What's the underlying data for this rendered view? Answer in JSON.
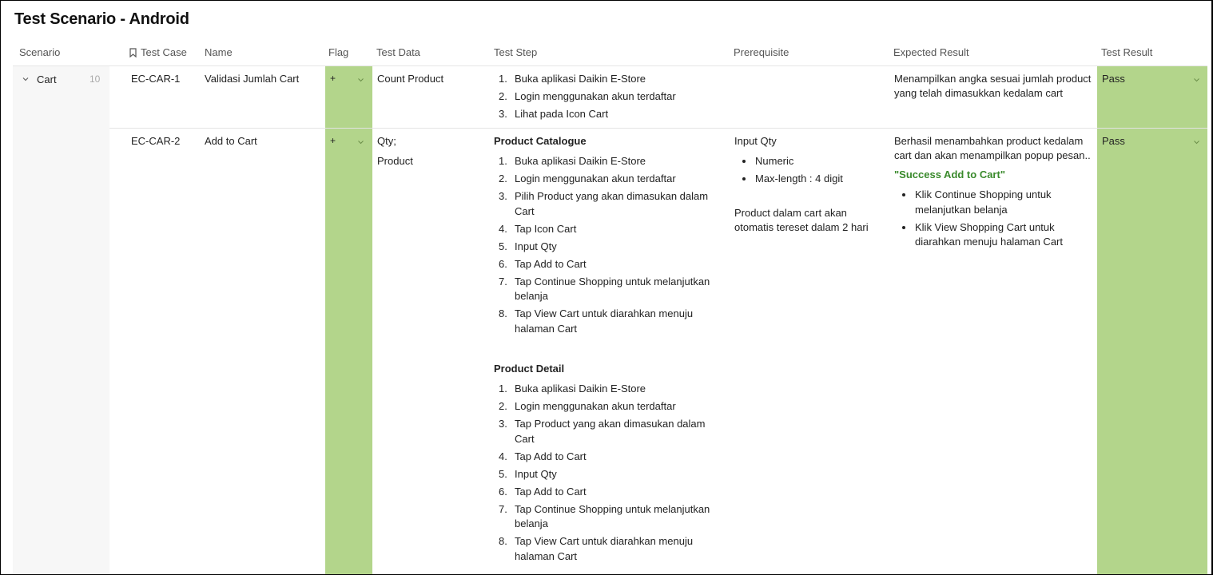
{
  "page": {
    "title": "Test Scenario - Android"
  },
  "columns": {
    "scenario": "Scenario",
    "test_case": "Test Case",
    "name": "Name",
    "flag": "Flag",
    "test_data": "Test Data",
    "test_step": "Test Step",
    "prerequisite": "Prerequisite",
    "expected_result": "Expected Result",
    "test_result": "Test Result"
  },
  "group": {
    "label": "Cart",
    "count": "10"
  },
  "colors": {
    "green_cell": "#b3d58b",
    "success_text": "#3a8a2c"
  },
  "rows": [
    {
      "test_case": "EC-CAR-1",
      "name": "Validasi Jumlah Cart",
      "flag": "+",
      "test_data": [
        "Count Product"
      ],
      "steps": [
        {
          "n": "1.",
          "t": "Buka aplikasi Daikin E-Store"
        },
        {
          "n": "2.",
          "t": "Login menggunakan akun terdaftar"
        },
        {
          "n": "3.",
          "t": "Lihat pada Icon Cart"
        }
      ],
      "expected": "Menampilkan angka sesuai jumlah product yang telah dimasukkan kedalam cart",
      "result": "Pass"
    },
    {
      "test_case": "EC-CAR-2",
      "name": "Add to Cart",
      "flag": "+",
      "test_data": [
        "Qty;",
        "Product"
      ],
      "catalogue_title": "Product Catalogue",
      "catalogue_steps": [
        {
          "n": "1.",
          "t": "Buka aplikasi Daikin E-Store"
        },
        {
          "n": "2.",
          "t": "Login menggunakan akun terdaftar"
        },
        {
          "n": "3.",
          "t": "Pilih Product yang akan dimasukan dalam Cart"
        },
        {
          "n": "4.",
          "t": "Tap Icon Cart"
        },
        {
          "n": "5.",
          "t": "Input Qty"
        },
        {
          "n": "6.",
          "t": "Tap Add to Cart"
        },
        {
          "n": "7.",
          "t": "Tap Continue Shopping untuk melanjutkan belanja"
        },
        {
          "n": "8.",
          "t": "Tap View Cart untuk diarahkan menuju halaman Cart"
        }
      ],
      "detail_title": "Product Detail",
      "detail_steps": [
        {
          "n": "1.",
          "t": "Buka aplikasi Daikin E-Store"
        },
        {
          "n": "2.",
          "t": "Login menggunakan akun terdaftar"
        },
        {
          "n": "3.",
          "t": "Tap Product yang akan dimasukan dalam Cart"
        },
        {
          "n": "4.",
          "t": "Tap Add to Cart"
        },
        {
          "n": "5.",
          "t": "Input Qty"
        },
        {
          "n": "6.",
          "t": "Tap Add to Cart"
        },
        {
          "n": "7.",
          "t": "Tap Continue Shopping untuk melanjutkan belanja"
        },
        {
          "n": "8.",
          "t": "Tap View Cart untuk diarahkan menuju halaman Cart"
        }
      ],
      "prereq_title": "Input Qty",
      "prereq_bullets": [
        "Numeric",
        "Max-length : 4 digit"
      ],
      "prereq_note": "Product dalam cart akan otomatis tereset dalam 2 hari",
      "expected": "Berhasil menambahkan product kedalam cart dan akan menampilkan popup pesan..",
      "expected_success": "\"Success Add to Cart\"",
      "expected_bullets": [
        "Klik Continue Shopping untuk melanjutkan belanja",
        "Klik View Shopping Cart untuk diarahkan menuju halaman Cart"
      ],
      "result": "Pass"
    }
  ]
}
